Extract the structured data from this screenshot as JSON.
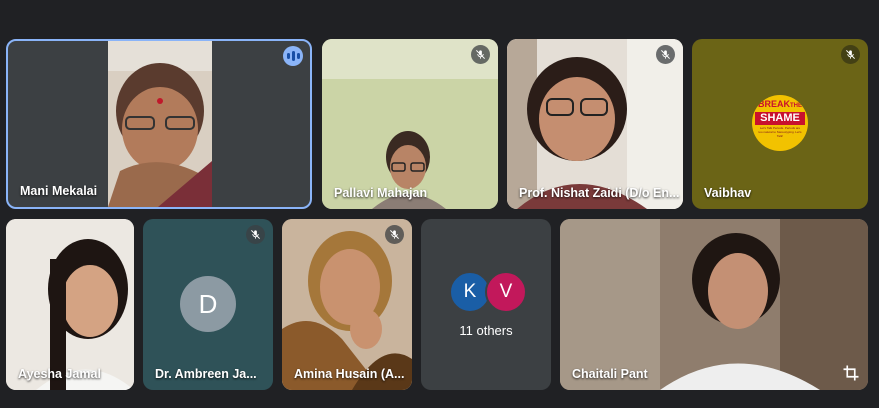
{
  "participants": {
    "p1": {
      "name": "Mani Mekalai"
    },
    "p2": {
      "name": "Pallavi Mahajan"
    },
    "p3": {
      "name": "Prof. Nishat Zaidi (D/o En..."
    },
    "p4": {
      "name": "Vaibhav",
      "logo_line1": "BREAK",
      "logo_line2": "THE",
      "logo_line3": "SHAME",
      "logo_small": "Let's Talk Periods. Periods are too natural to Stereotyping. Let's Talk!"
    },
    "p5": {
      "name": "Ayesha Jamal"
    },
    "p6": {
      "name": "Dr. Ambreen Ja...",
      "initial": "D"
    },
    "p7": {
      "name": "Amina Husain (A..."
    },
    "others": {
      "initial_a": "K",
      "initial_b": "V",
      "label": "11 others"
    },
    "p8": {
      "name": "Chaitali Pant"
    }
  },
  "colors": {
    "background": "#202124",
    "speaking_border": "#8ab4f8",
    "avatar_k": "#1a5ea6",
    "avatar_v": "#c2185b",
    "avatar_d": "#8c9aa3"
  },
  "icons": [
    "mic-off-icon",
    "audio-level-icon",
    "crop-icon"
  ]
}
